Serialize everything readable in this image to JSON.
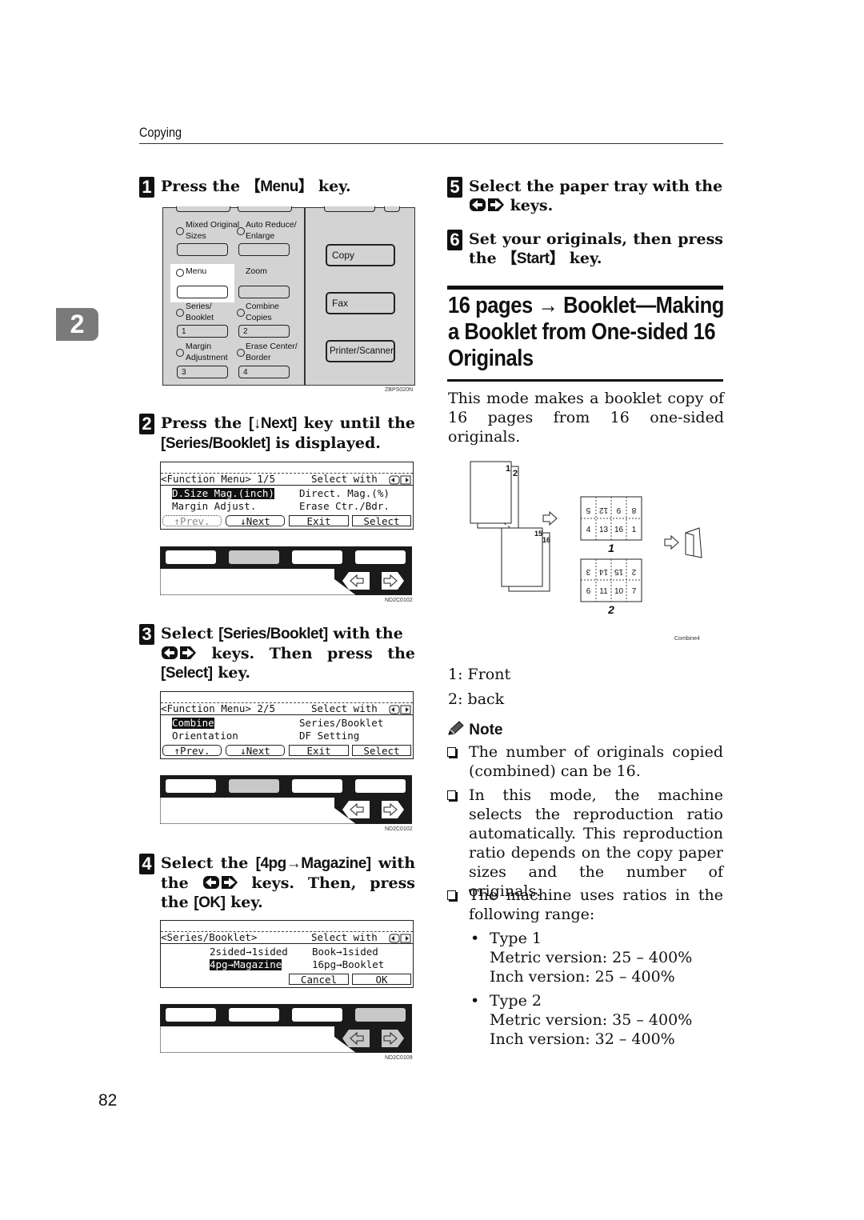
{
  "header": {
    "running_head": "Copying"
  },
  "chapter_tab": "2",
  "page_number": "82",
  "steps": [
    {
      "number": "1",
      "text_before": "Press the ",
      "key": "【Menu】",
      "text_after": " key."
    },
    {
      "number": "2",
      "text_before": "Press the ",
      "key": "[↓Next]",
      "text_mid": " key until the ",
      "key2": "[Series/Booklet]",
      "text_after": " is displayed."
    },
    {
      "number": "3",
      "text_before": "Select ",
      "key": "[Series/Booklet]",
      "text_mid": " with the ",
      "text_mid2": " keys. Then press the ",
      "key2": "[Select]",
      "text_after": " key."
    },
    {
      "number": "4",
      "text_before": "Select the ",
      "key": "[4pg→Magazine]",
      "text_mid": " with the ",
      "text_mid2": " keys. Then, press the ",
      "key2": "[OK]",
      "text_after": " key."
    },
    {
      "number": "5",
      "text_before": "Select the paper tray with the ",
      "text_after": " keys."
    },
    {
      "number": "6",
      "text_before": "Set your originals, then press the ",
      "key": "【Start】",
      "text_after": " key."
    }
  ],
  "control_panel": {
    "figure_code": "ZBPS020N",
    "buttons": [
      {
        "label": "Mixed Original Sizes",
        "line1": "Mixed Original",
        "line2": "Sizes",
        "key": ""
      },
      {
        "label": "Auto Reduce/ Enlarge",
        "line1": "Auto Reduce/",
        "line2": "Enlarge",
        "key": ""
      },
      {
        "label": "Menu",
        "line1": "Menu",
        "line2": "",
        "key": ""
      },
      {
        "label": "Zoom",
        "line1": "Zoom",
        "line2": "",
        "key": ""
      },
      {
        "label": "Series/ Booklet",
        "line1": "Series/",
        "line2": "Booklet",
        "key": "1"
      },
      {
        "label": "Combine Copies",
        "line1": "Combine",
        "line2": "Copies",
        "key": "2"
      },
      {
        "label": "Margin Adjustment",
        "line1": "Margin",
        "line2": "Adjustment",
        "key": "3"
      },
      {
        "label": "Erase Center/ Border",
        "line1": "Erase Center/",
        "line2": "Border",
        "key": "4"
      }
    ],
    "mode_keys": [
      "Copy",
      "Fax",
      "Printer/Scanner"
    ]
  },
  "screens": [
    {
      "title": "<Function Menu> 1/5",
      "select_with": "Select with",
      "left_items": [
        "D.Size Mag.(inch)",
        "Margin Adjust."
      ],
      "right_items": [
        "Direct. Mag.(%)",
        "Erase Ctr./Bdr."
      ],
      "highlighted": "D.Size Mag.(inch)",
      "softkeys": [
        "↑Prev.",
        "↓Next",
        "Exit",
        "Select"
      ],
      "keystrip_code": "ND2C0102",
      "active_key_index": 1
    },
    {
      "title": "<Function Menu> 2/5",
      "select_with": "Select with",
      "left_items": [
        "Combine",
        "Orientation"
      ],
      "right_items": [
        "Series/Booklet",
        "DF Setting"
      ],
      "highlighted": "Combine",
      "softkeys": [
        "↑Prev.",
        "↓Next",
        "Exit",
        "Select"
      ],
      "keystrip_code": "ND2C0102",
      "active_key_index": 1
    },
    {
      "title": "<Series/Booklet>",
      "select_with": "Select with",
      "left_items": [
        "2sided→1sided",
        "4pg→Magazine"
      ],
      "right_items": [
        "Book→1sided",
        "16pg→Booklet"
      ],
      "highlighted": "4pg→Magazine",
      "softkeys": [
        "Cancel",
        "OK"
      ],
      "keystrip_code": "ND2C0109",
      "active_key_index": 3
    }
  ],
  "section": {
    "title": "16 pages → Booklet—Making a Booklet from One-sided 16 Originals",
    "title_lines": [
      "16 pages → Booklet—Making",
      "a Booklet from One-sided 16",
      "Originals"
    ],
    "intro": "This mode makes a booklet copy of 16 pages from 16 one-sided originals.",
    "diagram": {
      "figure_code": "Combine4",
      "stack_top_pages": [
        "1",
        "2"
      ],
      "stack_bottom_pages": [
        "15",
        "16"
      ],
      "sheet1_label": "1",
      "sheet1_top_row": [
        "5",
        "12",
        "9",
        "8"
      ],
      "sheet1_bottom_row": [
        "4",
        "13",
        "16",
        "1"
      ],
      "sheet2_label": "2",
      "sheet2_top_row": [
        "3",
        "14",
        "15",
        "2"
      ],
      "sheet2_bottom_row": [
        "6",
        "11",
        "10",
        "7"
      ]
    },
    "legend": [
      "1: Front",
      "2: back"
    ],
    "note_heading": "Note",
    "notes": [
      "The number of originals copied (combined) can be 16.",
      "In this mode, the machine selects the reproduction ratio automatically. This reproduction ratio depends on the copy paper sizes and the number of originals.",
      "The machine uses ratios in the following range:"
    ],
    "note_lines": [
      [
        "The number of originals copied",
        "(combined) can be 16."
      ],
      [
        "In this mode, the machine selects",
        "the reproduction ratio automati-",
        "cally. This reproduction ratio de-",
        "pends on the copy paper sizes and",
        "the number of originals."
      ],
      [
        "The machine uses ratios in the fol-",
        "lowing range:"
      ]
    ],
    "ranges": [
      {
        "type": "Type 1",
        "metric": "Metric version: 25 – 400%",
        "inch": "Inch version: 25 – 400%"
      },
      {
        "type": "Type 2",
        "metric": "Metric version: 35 – 400%",
        "inch": "Inch version: 32 – 400%"
      }
    ]
  }
}
